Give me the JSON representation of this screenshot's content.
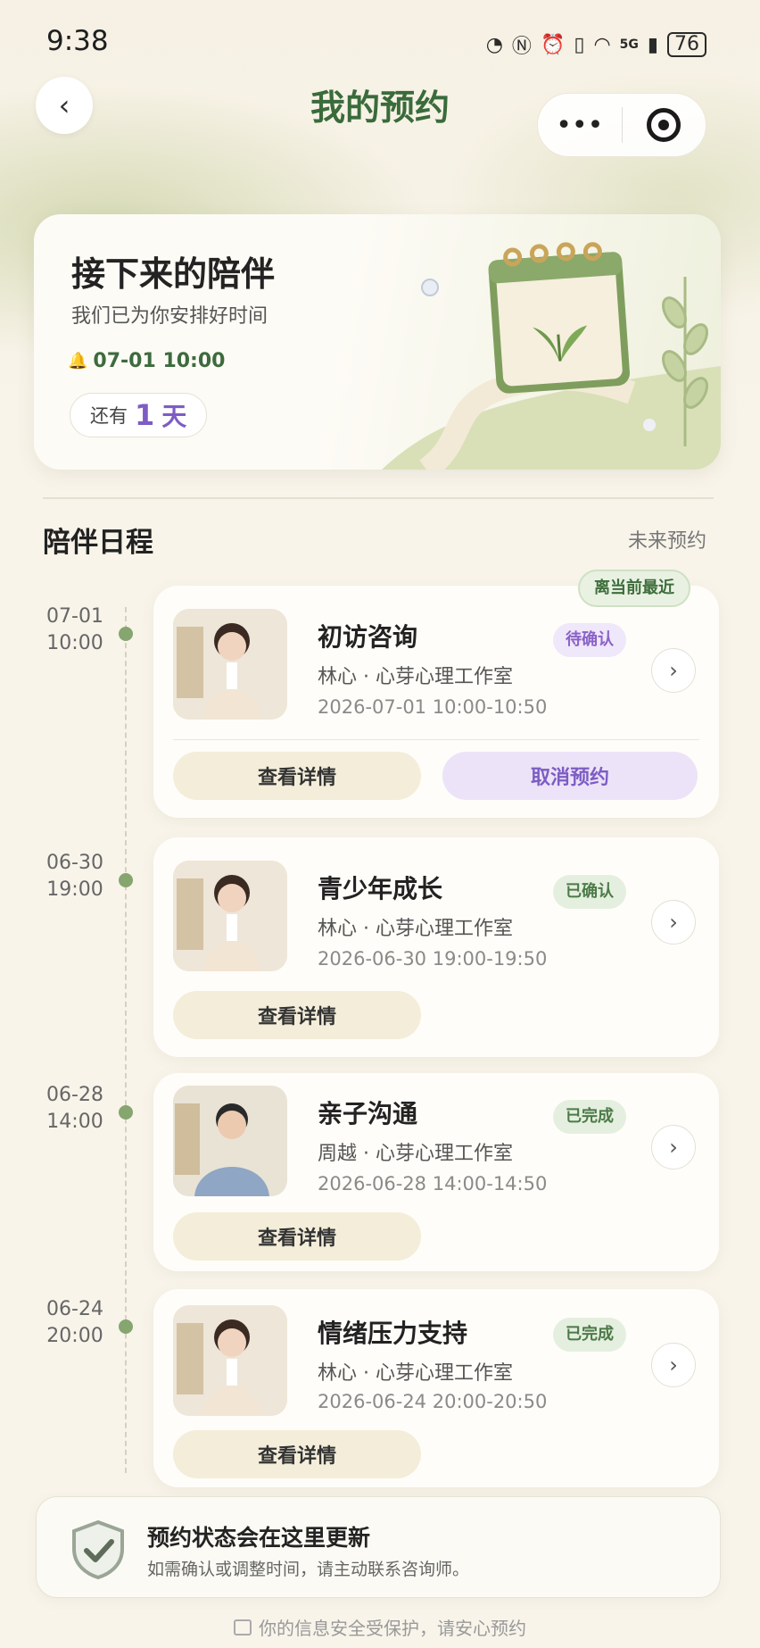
{
  "status_bar": {
    "time": "9:38",
    "battery": "76",
    "network": "5G"
  },
  "nav": {
    "title": "我的预约",
    "back_icon": "‹",
    "more_icon": "•••"
  },
  "hero": {
    "title": "接下来的陪伴",
    "subtitle": "我们已为你安排好时间",
    "next_time": "07-01 10:00",
    "countdown_prefix": "还有",
    "countdown_number": "1",
    "countdown_unit": "天"
  },
  "schedule": {
    "title": "陪伴日程",
    "link": "未来预约",
    "nearest_tag": "离当前最近",
    "items": [
      {
        "date": "07-01",
        "time": "10:00",
        "title": "初访咨询",
        "who": "林心 · 心芽心理工作室",
        "range": "2026-07-01 10:00-10:50",
        "status": "待确认",
        "detail": "查看详情",
        "cancel": "取消预约"
      },
      {
        "date": "06-30",
        "time": "19:00",
        "title": "青少年成长",
        "who": "林心 · 心芽心理工作室",
        "range": "2026-06-30 19:00-19:50",
        "status": "已确认",
        "detail": "查看详情"
      },
      {
        "date": "06-28",
        "time": "14:00",
        "title": "亲子沟通",
        "who": "周越 · 心芽心理工作室",
        "range": "2026-06-28 14:00-14:50",
        "status": "已完成",
        "detail": "查看详情"
      },
      {
        "date": "06-24",
        "time": "20:00",
        "title": "情绪压力支持",
        "who": "林心 · 心芽心理工作室",
        "range": "2026-06-24 20:00-20:50",
        "status": "已完成",
        "detail": "查看详情"
      }
    ]
  },
  "notice": {
    "title": "预约状态会在这里更新",
    "subtitle": "如需确认或调整时间，请主动联系咨询师。"
  },
  "secure": {
    "text": "你的信息安全受保护，请安心预约"
  },
  "colors": {
    "accent_green": "#3a6b3b",
    "accent_purple": "#7d5dc4",
    "bg": "#f8f4ea"
  }
}
